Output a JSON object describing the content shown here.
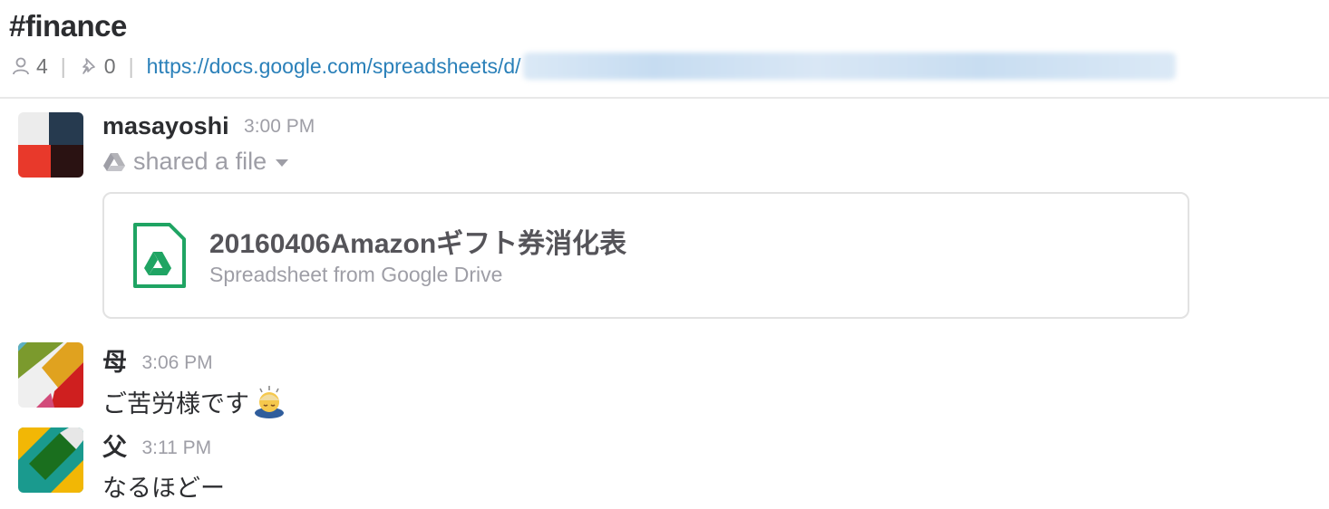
{
  "channel": {
    "title": "#finance",
    "members_count": "4",
    "pins_count": "0",
    "topic_link": "https://docs.google.com/spreadsheets/d/",
    "icons": {
      "members": "person-icon",
      "pins": "pin-icon"
    }
  },
  "messages": [
    {
      "sender": "masayoshi",
      "time": "3:00 PM",
      "action": "shared a file",
      "action_icon": "google-drive-icon",
      "file": {
        "title": "20160406Amazonギフト券消化表",
        "subtitle": "Spreadsheet from Google Drive",
        "icon": "google-drive-file-icon"
      }
    },
    {
      "sender": "母",
      "time": "3:06 PM",
      "text": "ご苦労様です",
      "emoji": "bowing-person-emoji"
    },
    {
      "sender": "父",
      "time": "3:11 PM",
      "text": "なるほどー"
    }
  ],
  "colors": {
    "link": "#2a80b9",
    "muted": "#9e9ea6",
    "drive_green": "#1fa463"
  }
}
